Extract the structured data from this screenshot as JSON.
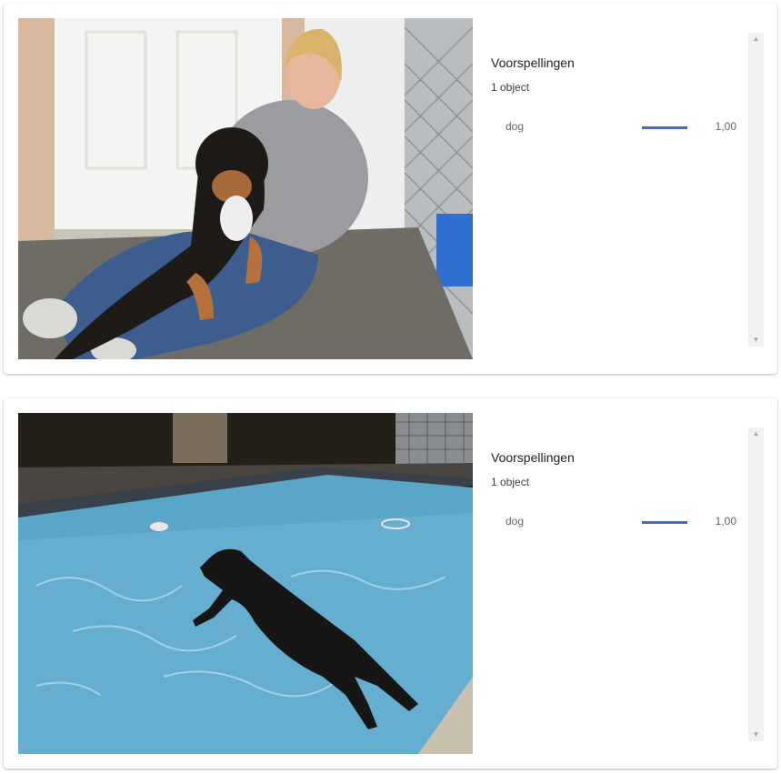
{
  "colors": {
    "accent_bar": "#3b6cc7",
    "card_bg": "#ffffff",
    "scrollbar_bg": "#f1f1f1"
  },
  "cards": [
    {
      "image_icon": "photo-woman-with-dog",
      "panel": {
        "title": "Voorspellingen",
        "count": "1 object",
        "predictions": [
          {
            "label": "dog",
            "score": "1,00",
            "confidence": 1.0
          }
        ]
      }
    },
    {
      "image_icon": "photo-dog-jumping-into-pool",
      "panel": {
        "title": "Voorspellingen",
        "count": "1 object",
        "predictions": [
          {
            "label": "dog",
            "score": "1,00",
            "confidence": 1.0
          }
        ]
      }
    }
  ],
  "scrollbar": {
    "up_icon": "triangle-up-icon",
    "down_icon": "triangle-down-icon",
    "up_glyph": "▲",
    "down_glyph": "▼"
  }
}
